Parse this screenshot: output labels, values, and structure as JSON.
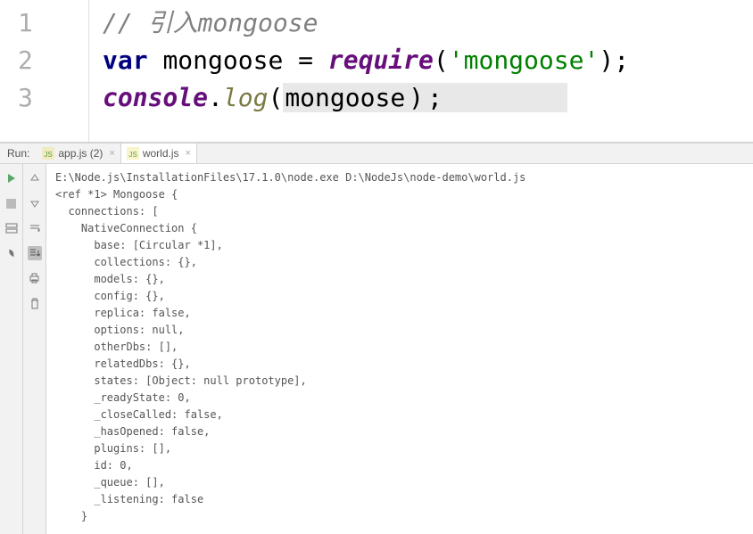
{
  "editor": {
    "lines": [
      {
        "num": "1"
      },
      {
        "num": "2"
      },
      {
        "num": "3"
      }
    ],
    "code": {
      "comment": "// 引入mongoose",
      "var_kw": "var",
      "mongoose1": "mongoose",
      "eq": " = ",
      "require": "require",
      "lparen": "(",
      "str_quote1": "'",
      "str_content": "mongoose",
      "str_quote2": "'",
      "rparen1": ")",
      "semi1": ";",
      "console": "console",
      "dot": ".",
      "log": "log",
      "lparen2": "(",
      "mongoose2": "mongoose",
      "rparen2": ")",
      "semi2": ";"
    }
  },
  "run": {
    "label": "Run:",
    "tabs": [
      {
        "name": "app.js (2)",
        "active": false
      },
      {
        "name": "world.js",
        "active": true
      }
    ]
  },
  "console": {
    "lines": [
      "E:\\Node.js\\InstallationFiles\\17.1.0\\node.exe D:\\NodeJs\\node-demo\\world.js",
      "<ref *1> Mongoose {",
      "  connections: [",
      "    NativeConnection {",
      "      base: [Circular *1],",
      "      collections: {},",
      "      models: {},",
      "      config: {},",
      "      replica: false,",
      "      options: null,",
      "      otherDbs: [],",
      "      relatedDbs: {},",
      "      states: [Object: null prototype],",
      "      _readyState: 0,",
      "      _closeCalled: false,",
      "      _hasOpened: false,",
      "      plugins: [],",
      "      id: 0,",
      "      _queue: [],",
      "      _listening: false",
      "    }"
    ]
  }
}
